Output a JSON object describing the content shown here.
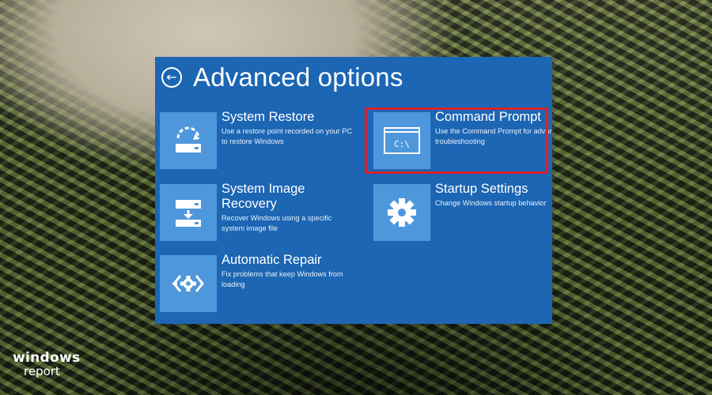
{
  "screen": {
    "title": "Advanced options",
    "options": [
      {
        "title": "System Restore",
        "description": "Use a restore point recorded on your PC to restore Windows",
        "icon": "restore-icon"
      },
      {
        "title": "Command Prompt",
        "description": "Use the Command Prompt for advanced troubleshooting",
        "icon": "command-prompt-icon",
        "highlighted": true
      },
      {
        "title": "System Image Recovery",
        "description": "Recover Windows using a specific system image file",
        "icon": "image-recovery-icon"
      },
      {
        "title": "Startup Settings",
        "description": "Change Windows startup behavior",
        "icon": "gear-icon"
      },
      {
        "title": "Automatic Repair",
        "description": "Fix problems that keep Windows from loading",
        "icon": "repair-icon"
      }
    ],
    "cmd_glyph": "C:\\"
  },
  "watermark": {
    "line1": "windows",
    "line2": "report"
  },
  "colors": {
    "panel": "#1c66b4",
    "tile": "#4f97dc",
    "highlight": "#d8232a"
  }
}
